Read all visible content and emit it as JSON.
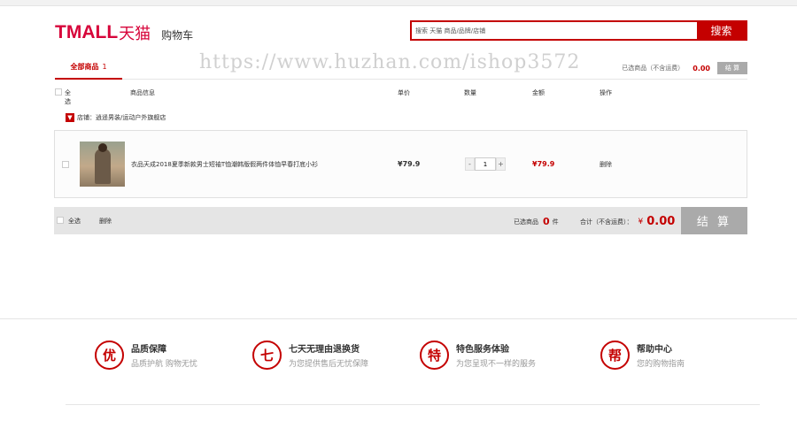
{
  "header": {
    "brand": "TMALL",
    "brand_cn": "天猫",
    "page_title": "购物车",
    "search_placeholder": "搜索 天猫 商品/品牌/店铺",
    "search_button": "搜索"
  },
  "watermark": "https://www.huzhan.com/ishop3572",
  "tabs": {
    "all_label": "全部商品",
    "all_count": "1"
  },
  "selected_summary": {
    "label": "已选商品（不含运费）",
    "price": "0.00",
    "button": "结 算"
  },
  "table_header": {
    "select_all": "全选",
    "info": "商品信息",
    "unit_price": "单价",
    "quantity": "数量",
    "amount": "金额",
    "action": "操作"
  },
  "shop": {
    "icon": "shop-icon",
    "label": "店铺：逍遥男装/运动户外旗舰店"
  },
  "items": [
    {
      "title": "衣品天成2018夏季新款男士短袖T恤潮韩版假两件体恤早春打底小衫",
      "unit_price": "¥79.9",
      "quantity": "1",
      "total": "¥79.9",
      "delete": "删除"
    }
  ],
  "qty_controls": {
    "minus": "-",
    "plus": "+"
  },
  "footer_bar": {
    "select_all": "全选",
    "delete": "删除",
    "selected_prefix": "已选商品",
    "selected_count": "0",
    "selected_suffix": "件",
    "total_label": "合计（不含运费）：",
    "currency": "¥",
    "total_value": "0.00",
    "settle": "结 算"
  },
  "guarantees": [
    {
      "icon_char": "优",
      "title": "品质保障",
      "subtitle": "品质护航 购物无忧"
    },
    {
      "icon_char": "七",
      "title": "七天无理由退换货",
      "subtitle": "为您提供售后无忧保障"
    },
    {
      "icon_char": "特",
      "title": "特色服务体验",
      "subtitle": "为您呈现不一样的服务"
    },
    {
      "icon_char": "帮",
      "title": "帮助中心",
      "subtitle": "您的购物指南"
    }
  ],
  "colors": {
    "accent": "#c40000",
    "brand": "#d7063b",
    "disabled_button": "#aaaaaa"
  }
}
